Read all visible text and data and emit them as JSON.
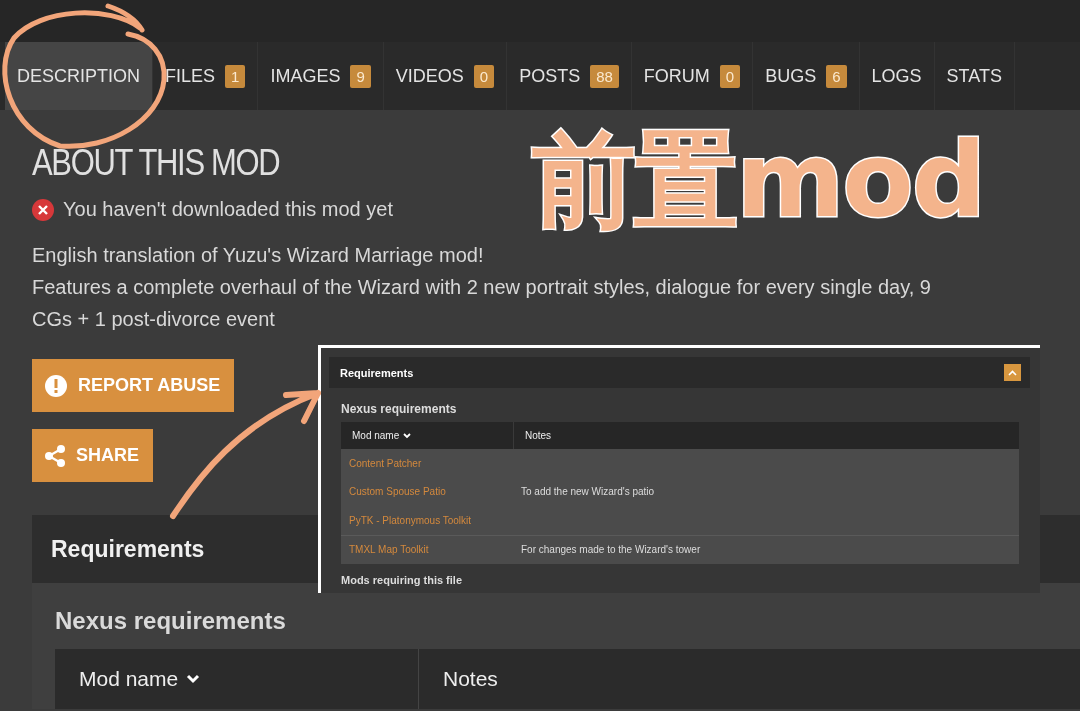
{
  "tabs": [
    {
      "label": "DESCRIPTION",
      "selected": true
    },
    {
      "label": "FILES",
      "count": "1",
      "selected": false
    },
    {
      "label": "IMAGES",
      "count": "9",
      "selected": false
    },
    {
      "label": "VIDEOS",
      "count": "0",
      "selected": false
    },
    {
      "label": "POSTS",
      "count": "88",
      "selected": false
    },
    {
      "label": "FORUM",
      "count": "0",
      "selected": false
    },
    {
      "label": "BUGS",
      "count": "6",
      "selected": false
    },
    {
      "label": "LOGS",
      "selected": false
    },
    {
      "label": "STATS",
      "selected": false
    }
  ],
  "about": {
    "title": "ABOUT THIS MOD",
    "download_status": "You haven't downloaded this mod yet",
    "description_lines": [
      "English translation of Yuzu's Wizard Marriage mod!",
      "Features a complete overhaul of the Wizard with 2 new portrait styles, dialogue for every single day, 9",
      "CGs + 1 post-divorce event"
    ]
  },
  "buttons": [
    {
      "kind": "report",
      "label": "REPORT ABUSE"
    },
    {
      "kind": "share",
      "label": "SHARE"
    }
  ],
  "requirements": {
    "title": "Requirements",
    "subheading": "Nexus requirements",
    "columns": [
      "Mod name",
      "Notes"
    ]
  },
  "annotation": {
    "caption": "前置mod"
  },
  "inset": {
    "title": "Requirements",
    "subheading": "Nexus requirements",
    "columns": [
      "Mod name",
      "Notes"
    ],
    "rows": [
      {
        "mod": "Content Patcher"
      },
      {
        "mod": "Custom Spouse Patio",
        "note": "To add the new Wizard's patio"
      },
      {
        "mod": "PyTK - Platonymous Toolkit"
      },
      {
        "mod": "TMXL Map Toolkit",
        "note": "For changes made to the Wizard's tower",
        "divider": true
      }
    ],
    "footer": "Mods requiring this file"
  }
}
